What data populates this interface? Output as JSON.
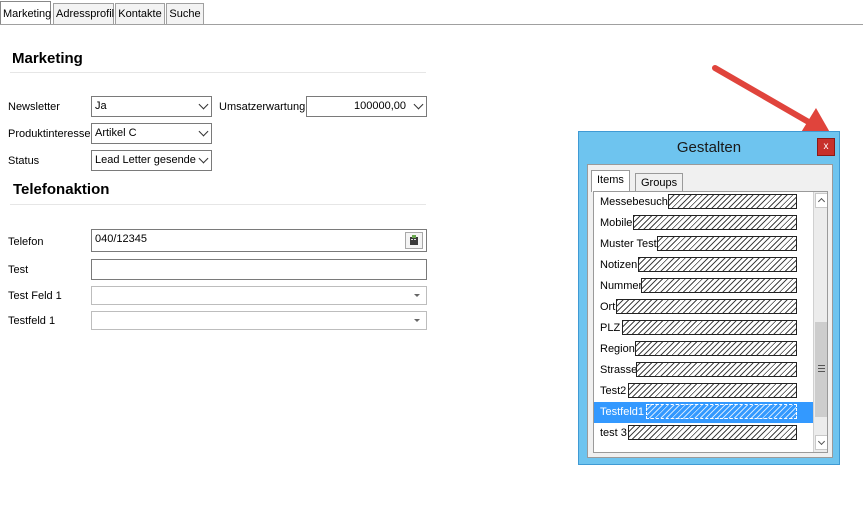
{
  "tabs": [
    "Marketing",
    "Adressprofil",
    "Kontakte",
    "Suche"
  ],
  "marketing": {
    "title": "Marketing",
    "newsletter_label": "Newsletter",
    "newsletter_value": "Ja",
    "umsatz_label": "Umsatzerwartung",
    "umsatz_value": "100000,00",
    "produkt_label": "Produktinteresse",
    "produkt_value": "Artikel C",
    "status_label": "Status",
    "status_value": "Lead Letter gesende"
  },
  "telefon": {
    "title": "Telefonaktion",
    "telefon_label": "Telefon",
    "telefon_value": "040/12345",
    "test_label": "Test",
    "test_value": "",
    "testfeld1_label": "Test Feld 1",
    "testfeld1_value": "",
    "testfeld1b_label": "Testfeld 1",
    "testfeld1b_value": ""
  },
  "dialog": {
    "title": "Gestalten",
    "close_label": "x",
    "tabs": [
      "Items",
      "Groups"
    ],
    "items": [
      "Messebesuch",
      "Mobile",
      "Muster Test",
      "Notizen",
      "Nummer",
      "Ort",
      "PLZ",
      "Region",
      "Strasse",
      "Test2",
      "Testfeld1",
      "test 3"
    ],
    "selected_item": "Testfeld1"
  },
  "colors": {
    "dialog_bg": "#6ec4ef",
    "selection": "#3399ff",
    "close_button": "#c7302b",
    "arrow": "#e0443c"
  },
  "icons": {
    "telefon_button": "phone-dial-icon",
    "annotation": "red-arrow-pointer"
  }
}
